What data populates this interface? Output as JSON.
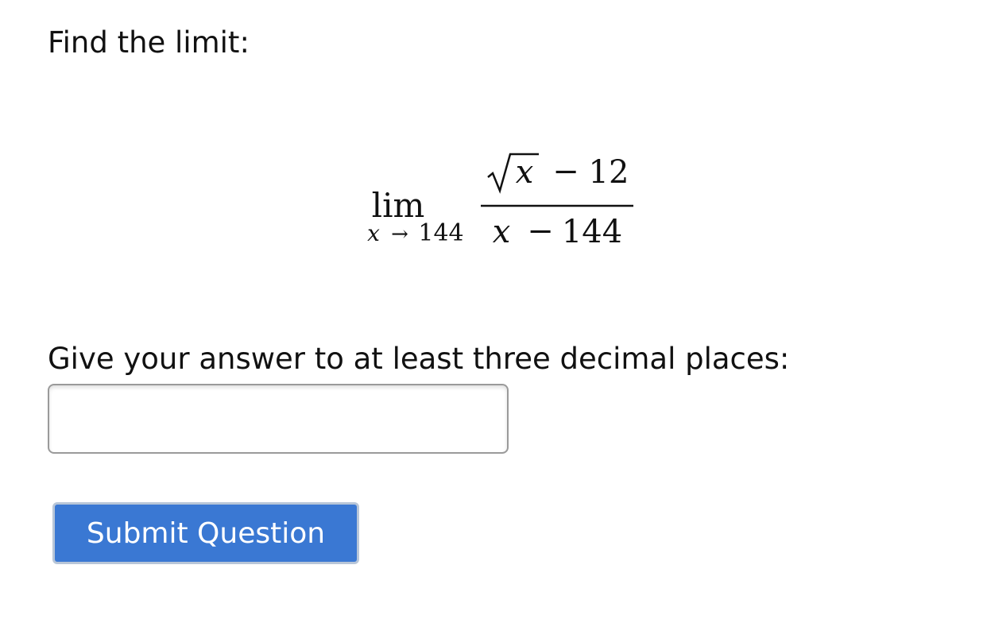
{
  "question": {
    "prompt": "Find the limit:",
    "limit": {
      "operator": "lim",
      "subscript_var": "x",
      "arrow": "→",
      "approach": "144",
      "numerator_var": "x",
      "numerator_minus": "−",
      "numerator_const": "12",
      "denominator_var": "x",
      "denominator_minus": "−",
      "denominator_const": "144"
    },
    "instruction": "Give your answer to at least three decimal places:"
  },
  "answer": {
    "value": "",
    "placeholder": ""
  },
  "submit": {
    "label": "Submit Question"
  }
}
